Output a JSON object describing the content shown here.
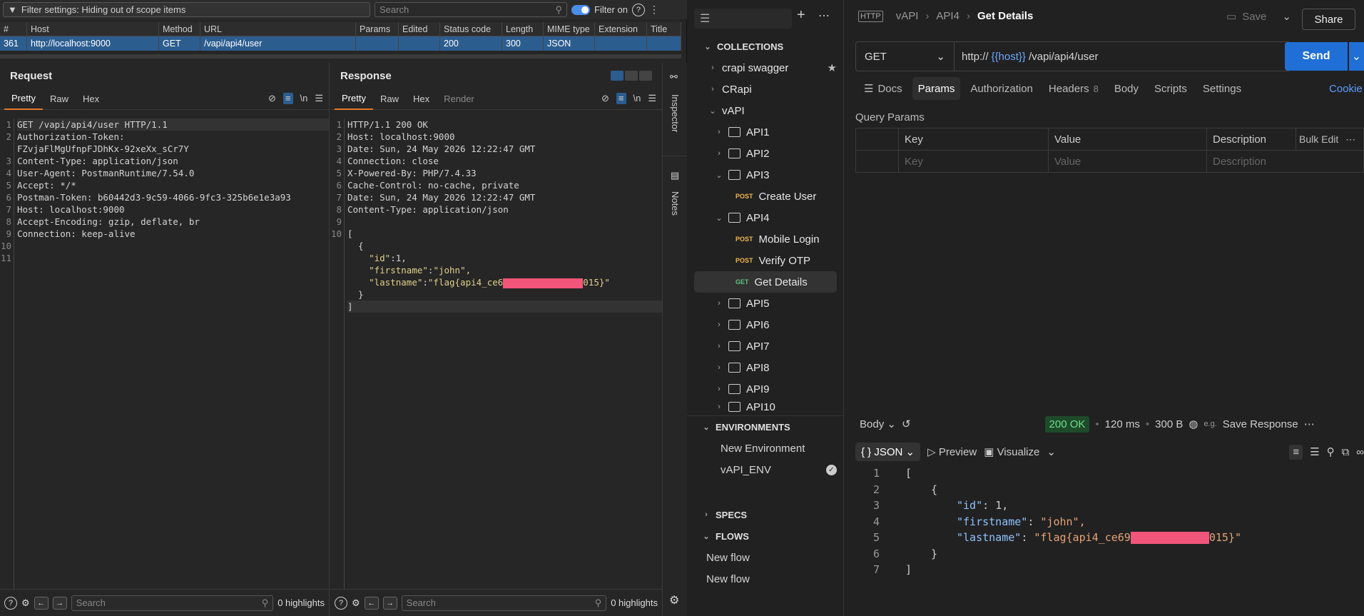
{
  "burp": {
    "filter_text": "Filter settings: Hiding out of scope items",
    "search_placeholder": "Search",
    "filter_on_label": "Filter on",
    "table": {
      "headers": [
        "#",
        "Host",
        "Method",
        "URL",
        "Params",
        "Edited",
        "Status code",
        "Length",
        "MIME type",
        "Extension",
        "Title"
      ],
      "row": {
        "num": "361",
        "host": "http://localhost:9000",
        "method": "GET",
        "url": "/vapi/api4/user",
        "params": "",
        "edited": "",
        "status": "200",
        "length": "300",
        "mime": "JSON",
        "ext": "",
        "title": ""
      }
    },
    "request": {
      "title": "Request",
      "tabs": [
        "Pretty",
        "Raw",
        "Hex"
      ],
      "line_numbers": [
        "1",
        "2",
        "",
        "3",
        "4",
        "5",
        "6",
        "7",
        "8",
        "9",
        "10",
        "11"
      ],
      "lines": [
        "GET /vapi/api4/user HTTP/1.1",
        "Authorization-Token:",
        "FZvjaFlMgUfnpFJDhKx-92xeXx_sCr7Y",
        "Content-Type: application/json",
        "User-Agent: PostmanRuntime/7.54.0",
        "Accept: */*",
        "Postman-Token: b60442d3-9c59-4066-9fc3-325b6e1e3a93",
        "Host: localhost:9000",
        "Accept-Encoding: gzip, deflate, br",
        "Connection: keep-alive",
        "",
        ""
      ]
    },
    "response": {
      "title": "Response",
      "tabs": [
        "Pretty",
        "Raw",
        "Hex",
        "Render"
      ],
      "line_numbers": [
        "1",
        "2",
        "3",
        "4",
        "5",
        "6",
        "7",
        "8",
        "9",
        "10",
        "",
        "",
        "",
        "",
        "",
        ""
      ],
      "header_lines": [
        "HTTP/1.1 200 OK",
        "Host: localhost:9000",
        "Date: Sun, 24 May 2026 12:22:47 GMT",
        "Connection: close",
        "X-Powered-By: PHP/7.4.33",
        "Cache-Control: no-cache, private",
        "Date: Sun, 24 May 2026 12:22:47 GMT",
        "Content-Type: application/json",
        ""
      ],
      "json": {
        "open": "[",
        "obj_open": "  {",
        "id_key": "\"id\"",
        "id_val": "1,",
        "fn_key": "\"firstname\"",
        "fn_val": "\"john\",",
        "ln_key": "\"lastname\"",
        "ln_prefix": "\"flag{api4_ce6",
        "ln_suffix": "015}\"",
        "obj_close": "  }",
        "close": "]"
      }
    },
    "sidestrip": {
      "inspector": "Inspector",
      "notes": "Notes"
    },
    "highlights": "0 highlights",
    "search_placeholder2": "Search"
  },
  "postman": {
    "sections": {
      "collections": "COLLECTIONS",
      "environments": "ENVIRONMENTS",
      "specs": "SPECS",
      "flows": "FLOWS"
    },
    "collections": {
      "crapi_swagger": "crapi swagger",
      "crapi": "CRapi",
      "vapi": "vAPI",
      "api1": "API1",
      "api2": "API2",
      "api3": "API3",
      "create_user": "Create User",
      "api4": "API4",
      "mobile_login": "Mobile Login",
      "verify_otp": "Verify OTP",
      "get_details": "Get Details",
      "api5": "API5",
      "api6": "API6",
      "api7": "API7",
      "api8": "API8",
      "api9": "API9",
      "api10": "API10"
    },
    "methods": {
      "post": "POST",
      "get": "GET"
    },
    "environments": [
      "New Environment",
      "vAPI_ENV"
    ],
    "flows": [
      "New flow",
      "New flow"
    ],
    "breadcrumb": {
      "a": "vAPI",
      "b": "API4",
      "c": "Get Details"
    },
    "save": "Save",
    "share": "Share",
    "method": "GET",
    "url_prefix": "http://",
    "url_var": "{{host}}",
    "url_path": "/vapi/api4/user",
    "send": "Send",
    "tabs": {
      "docs": "Docs",
      "params": "Params",
      "auth": "Authorization",
      "headers": "Headers",
      "headers_count": "8",
      "body": "Body",
      "scripts": "Scripts",
      "settings": "Settings",
      "cookies": "Cookie"
    },
    "query_params": "Query Params",
    "params_headers": {
      "key": "Key",
      "value": "Value",
      "description": "Description",
      "bulk": "Bulk Edit"
    },
    "params_placeholders": {
      "key": "Key",
      "value": "Value",
      "description": "Description"
    },
    "resp": {
      "body": "Body",
      "status": "200 OK",
      "time": "120 ms",
      "size": "300 B",
      "save_response": "Save Response",
      "format": "JSON",
      "preview": "Preview",
      "visualize": "Visualize",
      "line_numbers": [
        "1",
        "2",
        "3",
        "4",
        "5",
        "6",
        "7"
      ],
      "l1": "[",
      "l2": "{",
      "id_key": "\"id\"",
      "id_val": "1,",
      "fn_key": "\"firstname\"",
      "fn_val": "\"john\",",
      "ln_key": "\"lastname\"",
      "ln_prefix": "\"flag{api4_ce69",
      "ln_suffix": "015}\"",
      "l6": "}",
      "l7": "]"
    }
  }
}
